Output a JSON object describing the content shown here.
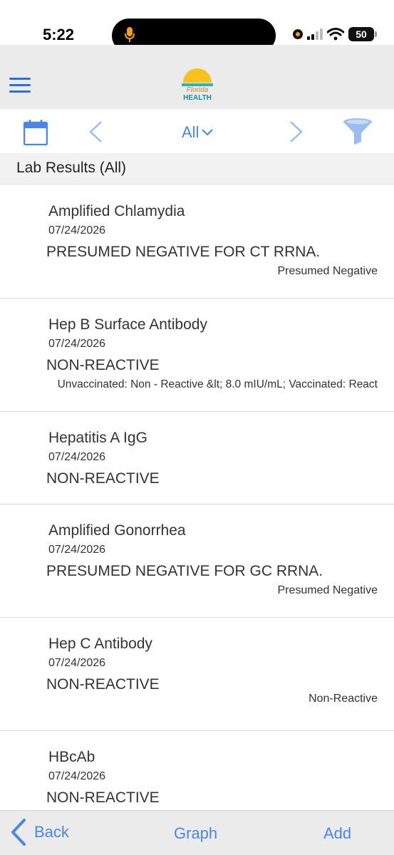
{
  "status_bar": {
    "time": "5:22",
    "battery": "50"
  },
  "toolbar": {
    "filter_label": "All"
  },
  "section": {
    "title": "Lab Results (All)"
  },
  "results": [
    {
      "name": "Amplified Chlamydia",
      "date": "07/24/2026",
      "value": "PRESUMED NEGATIVE FOR CT RRNA.",
      "note": "Presumed Negative"
    },
    {
      "name": "Hep B Surface Antibody",
      "date": "07/24/2026",
      "value": "NON-REACTIVE",
      "note": "Unvaccinated: Non - Reactive &lt; 8.0 mIU/mL; Vaccinated: React"
    },
    {
      "name": "Hepatitis A IgG",
      "date": "07/24/2026",
      "value": "NON-REACTIVE",
      "note": ""
    },
    {
      "name": "Amplified Gonorrhea",
      "date": "07/24/2026",
      "value": "PRESUMED NEGATIVE FOR GC RRNA.",
      "note": "Presumed Negative"
    },
    {
      "name": "Hep C Antibody",
      "date": "07/24/2026",
      "value": "NON-REACTIVE",
      "note": "Non-Reactive"
    },
    {
      "name": "HBcAb",
      "date": "07/24/2026",
      "value": "NON-REACTIVE",
      "note": ""
    }
  ],
  "bottom_bar": {
    "back_label": "Back",
    "graph_label": "Graph",
    "add_label": "Add"
  },
  "colors": {
    "accent": "#4a86e8",
    "header_bg": "#ebebeb"
  }
}
